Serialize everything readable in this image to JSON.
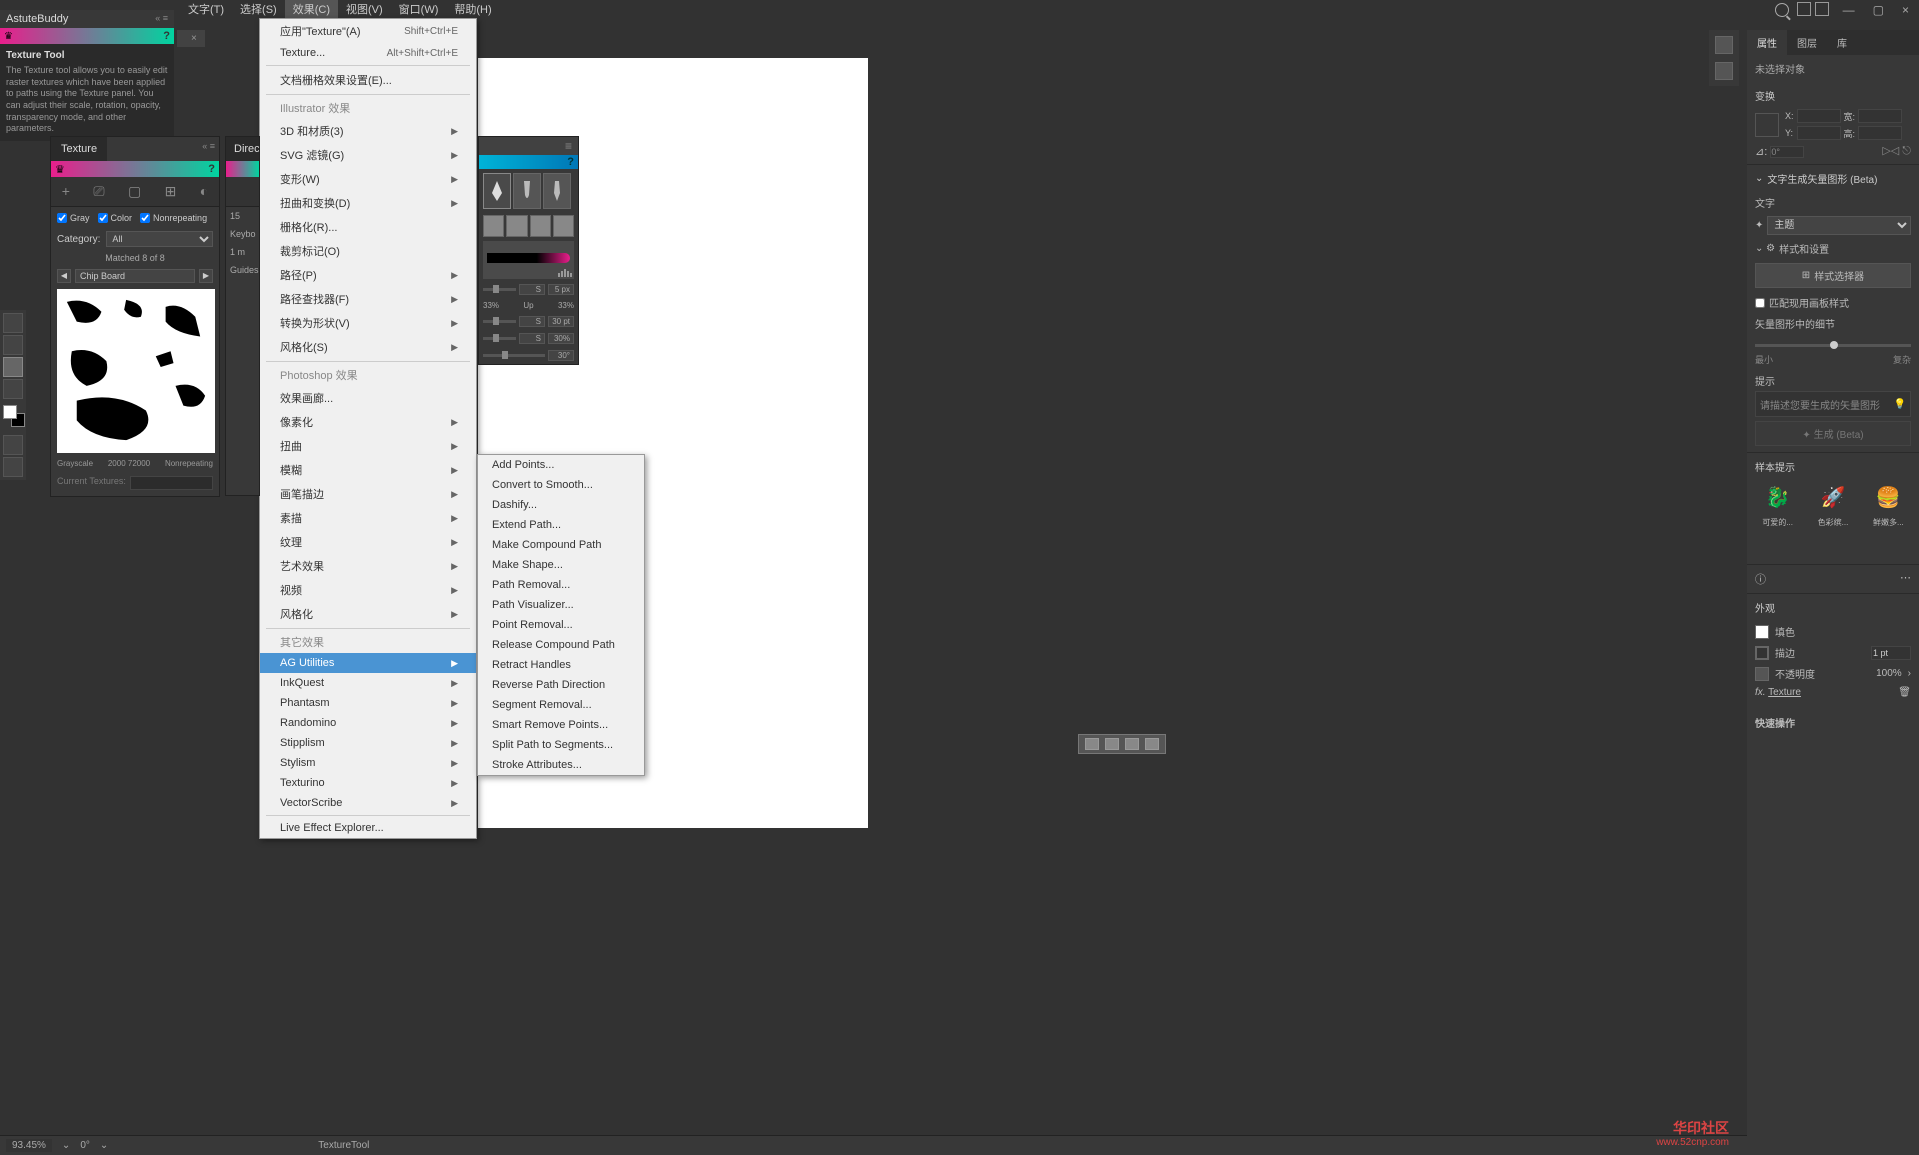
{
  "menubar": {
    "items": [
      "文字(T)",
      "选择(S)",
      "效果(C)",
      "视图(V)",
      "窗口(W)",
      "帮助(H)"
    ],
    "activeIndex": 2
  },
  "astuteBuddy": {
    "title": "AstuteBuddy",
    "toolTitle": "Texture Tool",
    "desc": "The Texture tool allows you to easily edit raster textures which have been applied to paths using the Texture panel. You can adjust their scale, rotation, opacity, transparency mode, and other parameters."
  },
  "docTab": {
    "close": "×"
  },
  "fxMenu": {
    "top": [
      {
        "label": "应用\"Texture\"(A)",
        "shortcut": "Shift+Ctrl+E"
      },
      {
        "label": "Texture...",
        "shortcut": "Alt+Shift+Ctrl+E"
      }
    ],
    "docSetup": "文档栅格效果设置(E)...",
    "illHeader": "Illustrator 效果",
    "ill": [
      {
        "label": "3D 和材质(3)",
        "sub": true
      },
      {
        "label": "SVG 滤镜(G)",
        "sub": true
      },
      {
        "label": "变形(W)",
        "sub": true
      },
      {
        "label": "扭曲和变换(D)",
        "sub": true
      },
      {
        "label": "栅格化(R)...",
        "sub": false
      },
      {
        "label": "裁剪标记(O)",
        "sub": false
      },
      {
        "label": "路径(P)",
        "sub": true
      },
      {
        "label": "路径查找器(F)",
        "sub": true
      },
      {
        "label": "转换为形状(V)",
        "sub": true
      },
      {
        "label": "风格化(S)",
        "sub": true
      }
    ],
    "psHeader": "Photoshop 效果",
    "ps": [
      {
        "label": "效果画廊...",
        "sub": false
      },
      {
        "label": "像素化",
        "sub": true
      },
      {
        "label": "扭曲",
        "sub": true
      },
      {
        "label": "模糊",
        "sub": true
      },
      {
        "label": "画笔描边",
        "sub": true
      },
      {
        "label": "素描",
        "sub": true
      },
      {
        "label": "纹理",
        "sub": true
      },
      {
        "label": "艺术效果",
        "sub": true
      },
      {
        "label": "视频",
        "sub": true
      },
      {
        "label": "风格化",
        "sub": true
      }
    ],
    "otherHeader": "其它效果",
    "plugins": [
      {
        "label": "AG Utilities",
        "highlight": true
      },
      {
        "label": "InkQuest"
      },
      {
        "label": "Phantasm"
      },
      {
        "label": "Randomino"
      },
      {
        "label": "Stipplism"
      },
      {
        "label": "Stylism"
      },
      {
        "label": "Texturino"
      },
      {
        "label": "VectorScribe"
      }
    ],
    "liveEffect": "Live Effect Explorer..."
  },
  "agSub": [
    "Add Points...",
    "Convert to Smooth...",
    "Dashify...",
    "Extend Path...",
    "Make Compound Path",
    "Make Shape...",
    "Path Removal...",
    "Path Visualizer...",
    "Point Removal...",
    "Release Compound Path",
    "Retract Handles",
    "Reverse Path Direction",
    "Segment Removal...",
    "Smart Remove Points...",
    "Split Path to Segments...",
    "Stroke Attributes..."
  ],
  "texturePanel": {
    "tab": "Texture",
    "checks": {
      "gray": "Gray",
      "color": "Color",
      "nonrep": "Nonrepeating"
    },
    "categoryLabel": "Category:",
    "categoryValue": "All",
    "matched": "Matched 8 of 8",
    "chipName": "Chip Board",
    "info": {
      "mode": "Grayscale",
      "res": "2000 72000",
      "rep": "Nonrepeating"
    },
    "current": "Current Textures:"
  },
  "directPanel": {
    "tab": "Direc",
    "num": "15",
    "keyb": "Keybo",
    "one": "1 m",
    "guides": "Guides"
  },
  "brushPanel": {
    "sizeVal": "5 px",
    "sizeIcon": "S",
    "pct": "33%",
    "up": "Up",
    "pct2": "33%",
    "ptVal": "30 pt",
    "ptIcon": "S",
    "pctVal": "30%",
    "pctIcon": "S",
    "angVal": "30°"
  },
  "props": {
    "tabs": [
      "属性",
      "图层",
      "库"
    ],
    "noSelection": "未选择对象",
    "transform": {
      "title": "变换",
      "x": "X:",
      "xval": "",
      "y": "Y:",
      "yval": "",
      "w": "宽:",
      "wval": "",
      "h": "高:",
      "hval": "",
      "angle": "⊿:",
      "aval": "0°"
    },
    "textGen": {
      "title": "文字生成矢量图形 (Beta)",
      "textLabel": "文字",
      "themeVal": "主题",
      "styleSettings": "样式和设置",
      "stylePicker": "样式选择器",
      "matchArtboard": "匹配现用画板样式",
      "detail": "矢量图形中的细节",
      "min": "最小",
      "max": "复杂",
      "promptLabel": "提示",
      "promptPlaceholder": "请描述您要生成的矢量图形",
      "genBtn": "生成 (Beta)"
    },
    "samples": {
      "title": "样本提示",
      "items": [
        {
          "emoji": "🐉",
          "label": "可爱的..."
        },
        {
          "emoji": "🚀",
          "label": "色彩缤..."
        },
        {
          "emoji": "🍔",
          "label": "鲜嫩多..."
        }
      ]
    },
    "appearance": {
      "title": "外观",
      "fill": "填色",
      "stroke": "描边",
      "strokeVal": "1 pt",
      "opacity": "不透明度",
      "opVal": "100%",
      "fx": "fx.",
      "texture": "Texture"
    },
    "quick": "快速操作"
  },
  "statusbar": {
    "zoom": "93.45%",
    "angle": "0°",
    "tool": "TextureTool"
  },
  "watermark": {
    "l1": "华印社区",
    "l2": "www.52cnp.com"
  }
}
